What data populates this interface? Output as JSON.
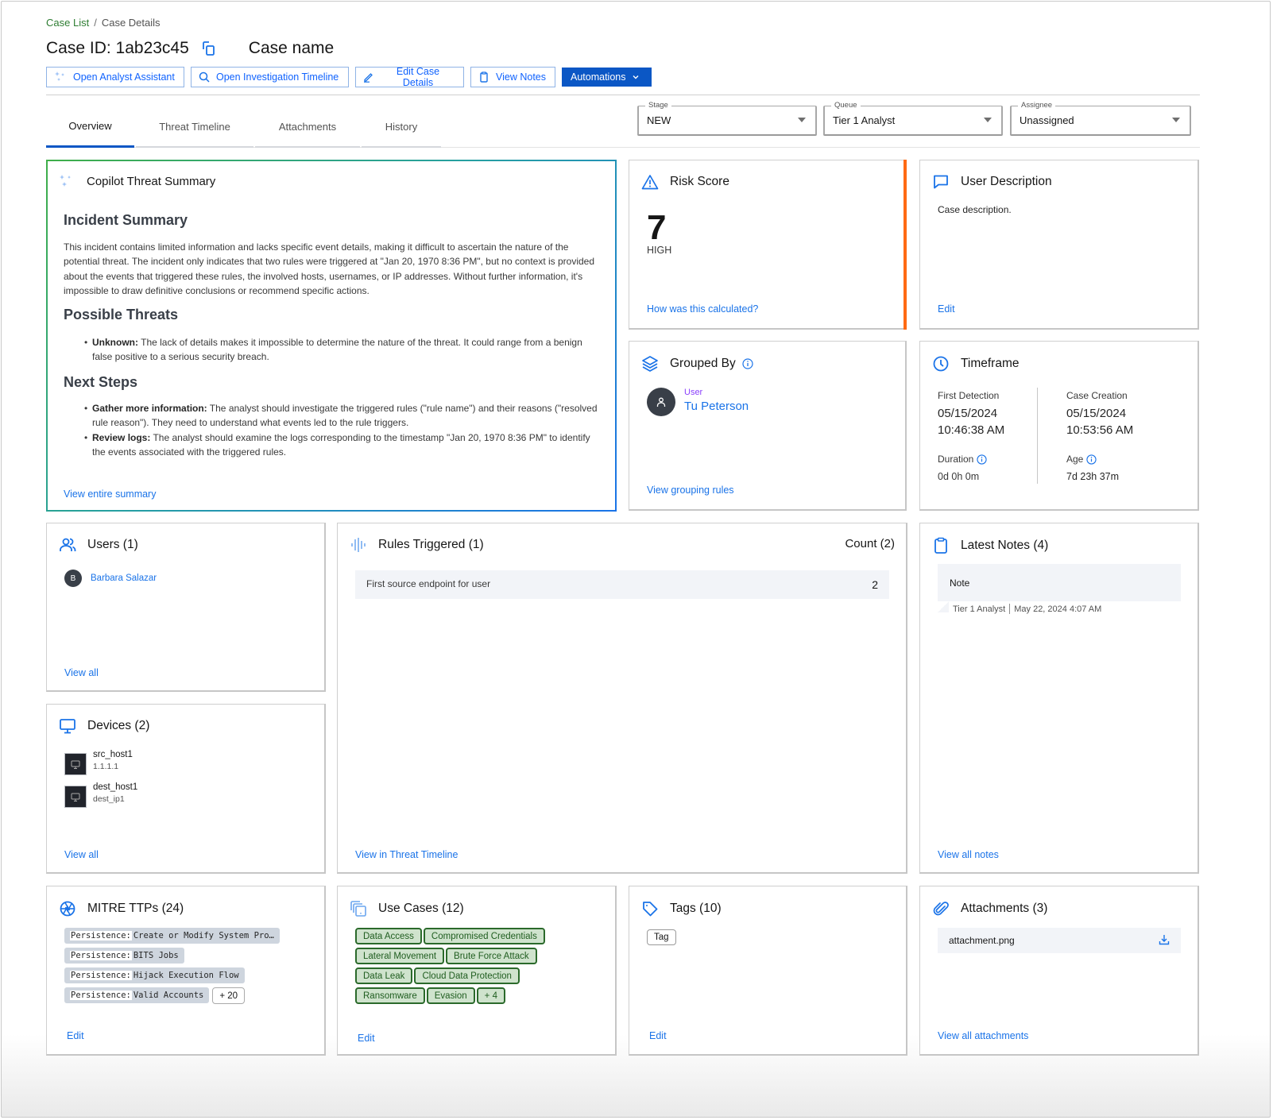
{
  "breadcrumb": {
    "items": [
      "Case List",
      "Case Details"
    ],
    "separator": "/"
  },
  "header": {
    "case_id": "Case ID: 1ab23c45",
    "case_name": "Case name"
  },
  "actions": {
    "analyst_assistant": "Open Analyst Assistant",
    "investigation_timeline": "Open Investigation Timeline",
    "edit_case": "Edit Case Details",
    "view_notes": "View Notes",
    "automations": "Automations"
  },
  "tabs": [
    {
      "label": "Overview",
      "active": true
    },
    {
      "label": "Threat Timeline",
      "active": false
    },
    {
      "label": "Attachments",
      "active": false
    },
    {
      "label": "History",
      "active": false
    }
  ],
  "fields": {
    "stage": {
      "label": "Stage",
      "value": "NEW"
    },
    "queue": {
      "label": "Queue",
      "value": "Tier 1 Analyst"
    },
    "assignee": {
      "label": "Assignee",
      "value": "Unassigned"
    }
  },
  "copilot": {
    "title": "Copilot Threat Summary",
    "incident_heading": "Incident Summary",
    "incident_text": "This incident contains limited information and lacks specific event details, making it difficult to ascertain the nature of the potential threat. The incident only indicates that two rules were triggered at \"Jan 20, 1970 8:36 PM\", but no context is provided about the events that triggered these rules, the involved hosts, usernames, or IP addresses. Without further information, it's impossible to draw definitive conclusions or recommend specific actions.",
    "threats_heading": "Possible Threats",
    "threats": [
      {
        "label": "Unknown:",
        "text": " The lack of details makes it impossible to determine the nature of the threat. It could range from a benign false positive to a serious security breach."
      }
    ],
    "steps_heading": "Next Steps",
    "steps": [
      {
        "label": "Gather more information:",
        "text": " The analyst should investigate the triggered rules (\"rule name\") and their reasons (\"resolved rule reason\"). They need to understand what events led to the rule triggers."
      },
      {
        "label": "Review logs:",
        "text": " The analyst should examine the logs corresponding to the timestamp \"Jan 20, 1970 8:36 PM\" to identify the events associated with the triggered rules."
      }
    ],
    "link": "View entire summary"
  },
  "risk": {
    "title": "Risk Score",
    "score": "7",
    "severity": "HIGH",
    "link": "How was this calculated?",
    "accent_color": "#ff6a13"
  },
  "user_description": {
    "title": "User Description",
    "text": "Case description.",
    "link": "Edit"
  },
  "grouped_by": {
    "title": "Grouped By",
    "type_label": "User",
    "name": "Tu Peterson",
    "link": "View grouping rules"
  },
  "timeframe": {
    "title": "Timeframe",
    "first_detection_label": "First Detection",
    "first_detection_date": "05/15/2024",
    "first_detection_time": "10:46:38 AM",
    "case_creation_label": "Case Creation",
    "case_creation_date": "05/15/2024",
    "case_creation_time": "10:53:56 AM",
    "duration_label": "Duration",
    "duration_value": "0d 0h 0m",
    "age_label": "Age",
    "age_value": "7d 23h 37m"
  },
  "users": {
    "title": "Users (1)",
    "items": [
      {
        "initial": "B",
        "name": "Barbara Salazar"
      }
    ],
    "link": "View all"
  },
  "devices": {
    "title": "Devices (2)",
    "items": [
      {
        "name": "src_host1",
        "sub": "1.1.1.1"
      },
      {
        "name": "dest_host1",
        "sub": "dest_ip1"
      }
    ],
    "link": "View all"
  },
  "rules": {
    "title": "Rules Triggered (1)",
    "count_label": "Count (2)",
    "items": [
      {
        "name": "First source endpoint for user",
        "count": "2"
      }
    ],
    "link": "View in Threat Timeline"
  },
  "notes": {
    "title": "Latest Notes (4)",
    "items": [
      {
        "text": "Note",
        "author": "Tier 1 Analyst",
        "date": "May 22, 2024 4:07 AM"
      }
    ],
    "link": "View all notes"
  },
  "mitre": {
    "title": "MITRE TTPs (24)",
    "items": [
      {
        "tactic": "Persistence:",
        "technique": "Create or Modify System Pro…"
      },
      {
        "tactic": "Persistence:",
        "technique": "BITS Jobs"
      },
      {
        "tactic": "Persistence:",
        "technique": "Hijack Execution Flow"
      },
      {
        "tactic": "Persistence:",
        "technique": "Valid Accounts"
      }
    ],
    "more": "+ 20",
    "link": "Edit"
  },
  "use_cases": {
    "title": "Use Cases (12)",
    "items": [
      "Data Access",
      "Compromised Credentials",
      "Lateral Movement",
      "Brute Force Attack",
      "Data Leak",
      "Cloud Data Protection",
      "Ransomware",
      "Evasion"
    ],
    "more": "+ 4",
    "link": "Edit"
  },
  "tags": {
    "title": "Tags (10)",
    "items": [
      "Tag"
    ],
    "link": "Edit"
  },
  "attachments": {
    "title": "Attachments (3)",
    "items": [
      {
        "name": "attachment.png"
      }
    ],
    "link": "View all attachments"
  },
  "colors": {
    "primary": "#0b57c5",
    "link": "#1a73e8",
    "risk_accent": "#ff6a13",
    "usecase_bg": "#cfe3cd",
    "usecase_border": "#2b6a2b",
    "user_type": "#8a3ffc"
  }
}
